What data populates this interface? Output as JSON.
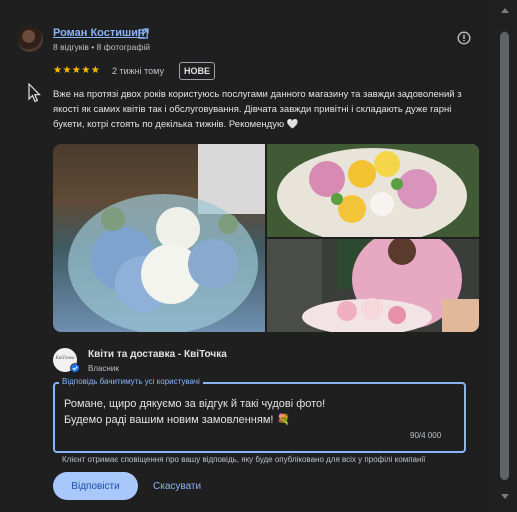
{
  "reviewer": {
    "name": "Роман Костишин",
    "stats": "8 відгуків • 8 фотографій",
    "avatar_icon": "user-avatar"
  },
  "review": {
    "rating": 5,
    "stars_text": "★★★★★",
    "date": "2 тижні тому",
    "badge": "НОВЕ",
    "text": "Вже на протязі двох років користуюсь послугами данного магазину та завжди задоволений з якості як самих квітів так і обслуговування. Дівчата завжди привітні і складають дуже гарні букети, котрі стоять по декілька тижнів. Рекомендую 🤍",
    "photos": [
      "blue-hydrangea-bouquet",
      "yellow-pink-flower-box",
      "woman-holding-bouquet"
    ]
  },
  "owner": {
    "avatar_text": "КвіТочка",
    "name": "Квіти та доставка - КвіТочка",
    "role": "Власник"
  },
  "reply": {
    "legend": "Відповідь бачитимуть усі користувачі",
    "text": "Романе, щиро дякуємо за відгук й такі чудові фото!\nБудемо раді вашим новим замовленням! 💐",
    "char_count": "90/4 000",
    "notice": "Клієнт отримає сповіщення про вашу відповідь, яку буде опубліковано для всіх у профілі компанії",
    "submit_label": "Відповісти",
    "cancel_label": "Скасувати"
  },
  "colors": {
    "background": "#1f1f1f",
    "accent": "#8ab4f8",
    "star": "#fbbc04",
    "button_bg": "#a8c7fa"
  }
}
